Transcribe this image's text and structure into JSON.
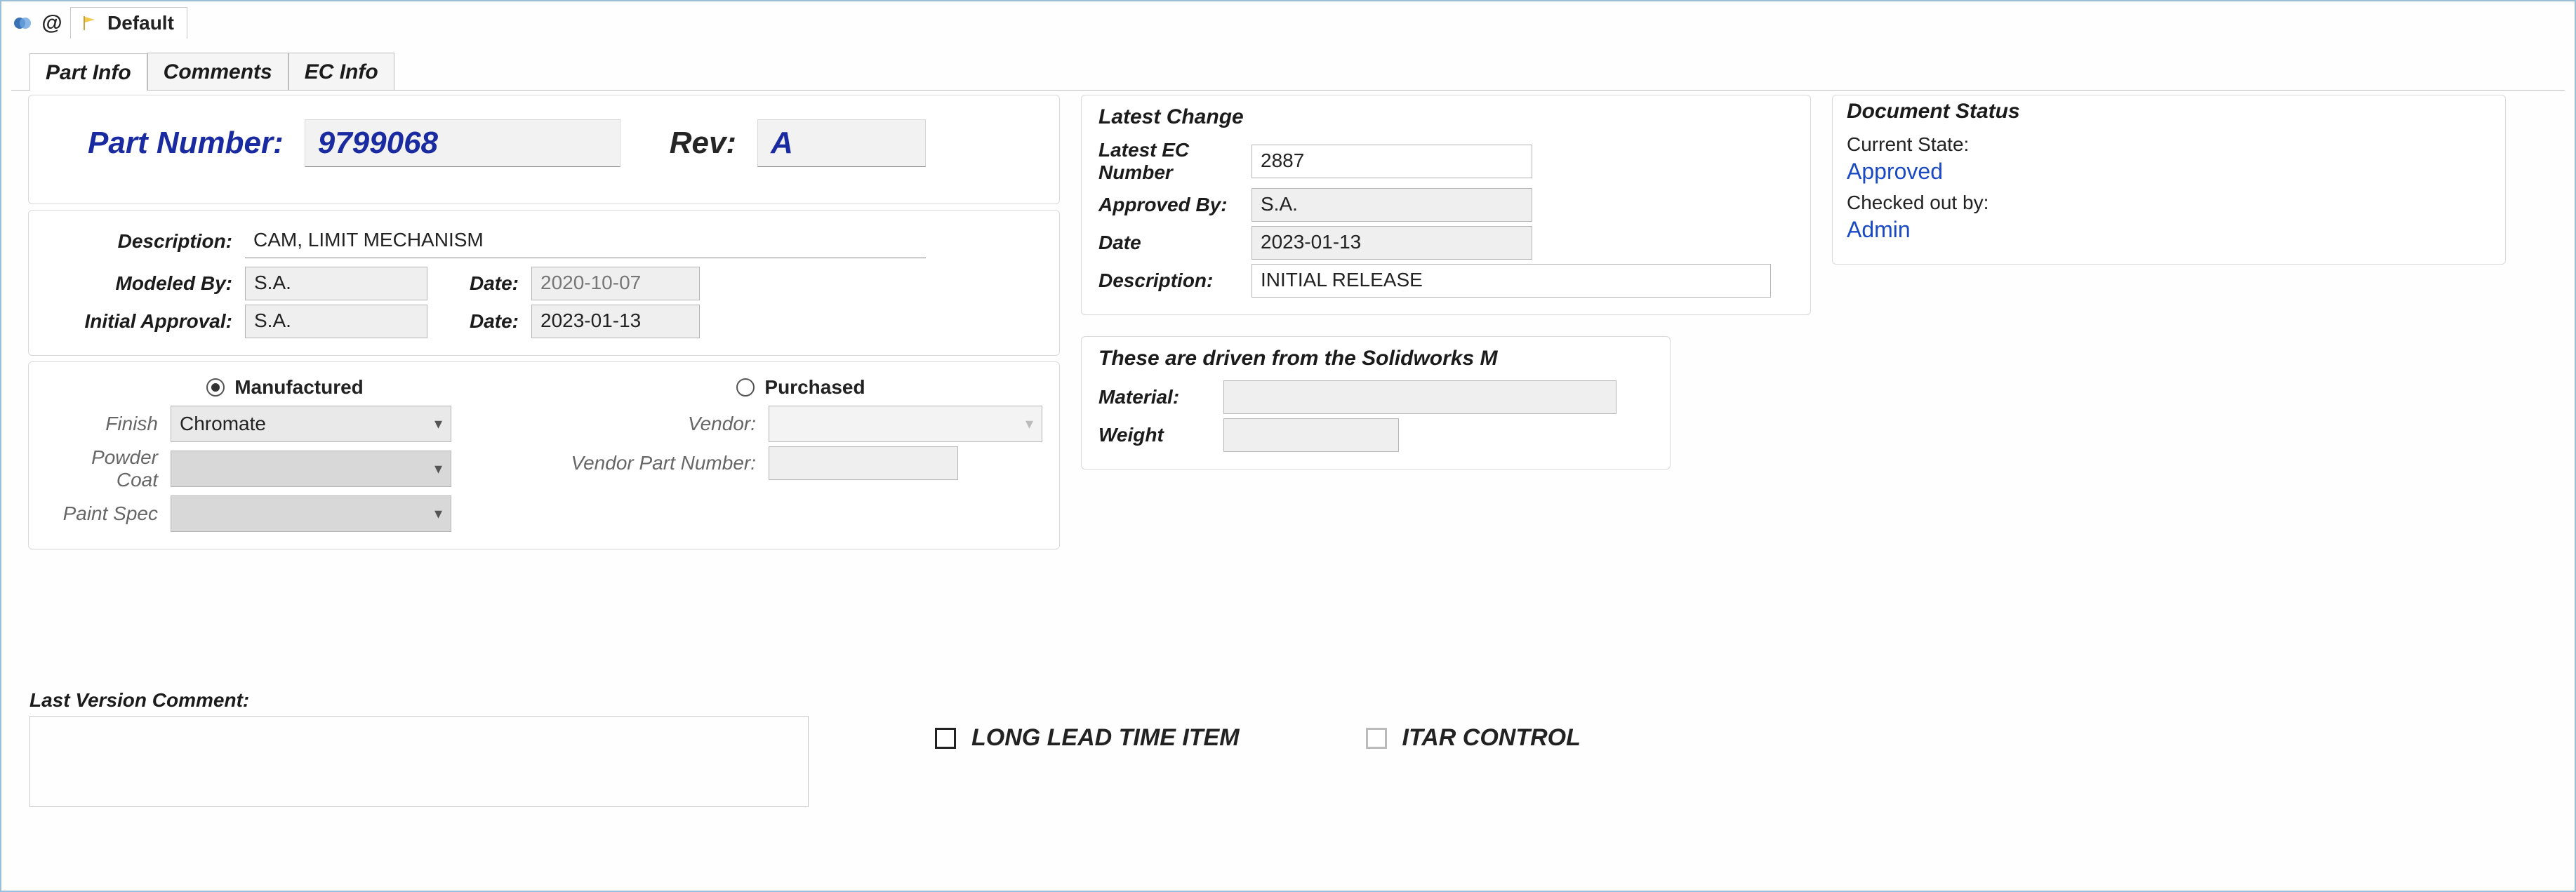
{
  "topTab": {
    "title": "Default"
  },
  "tabs": {
    "partInfo": "Part Info",
    "comments": "Comments",
    "ecInfo": "EC Info"
  },
  "partNumber": {
    "label": "Part Number:",
    "value": "9799068",
    "revLabel": "Rev:",
    "revValue": "A"
  },
  "desc": {
    "descriptionLabel": "Description:",
    "description": "CAM, LIMIT MECHANISM",
    "modeledByLabel": "Modeled By:",
    "modeledBy": "S.A.",
    "modeledDateLabel": "Date:",
    "modeledDate": "2020-10-07",
    "initialApprovalLabel": "Initial Approval:",
    "initialApproval": "S.A.",
    "initialDateLabel": "Date:",
    "initialDate": "2023-01-13"
  },
  "sourcing": {
    "manufacturedLabel": "Manufactured",
    "purchasedLabel": "Purchased",
    "finishLabel": "Finish",
    "finish": "Chromate",
    "powderCoatLabel": "Powder Coat",
    "powderCoat": "",
    "paintSpecLabel": "Paint Spec",
    "paintSpec": "",
    "vendorLabel": "Vendor:",
    "vendor": "",
    "vendorPNLabel": "Vendor Part Number:",
    "vendorPN": ""
  },
  "latest": {
    "title": "Latest Change",
    "ecLabel": "Latest EC Number",
    "ec": "2887",
    "approvedByLabel": "Approved By:",
    "approvedBy": "S.A.",
    "dateLabel": "Date",
    "date": "2023-01-13",
    "descriptionLabel": "Description:",
    "description": "INITIAL RELEASE"
  },
  "sw": {
    "title": "These are driven from the Solidworks M",
    "materialLabel": "Material:",
    "material": "",
    "weightLabel": "Weight",
    "weight": ""
  },
  "docStatus": {
    "title": "Document Status",
    "currentStateLabel": "Current State:",
    "currentState": "Approved",
    "checkedOutLabel": "Checked out by:",
    "checkedOutBy": "Admin"
  },
  "bottom": {
    "lastVersionCommentLabel": "Last Version Comment:",
    "lastVersionComment": "",
    "longLeadLabel": "LONG LEAD TIME ITEM",
    "itarLabel": "ITAR CONTROL"
  }
}
